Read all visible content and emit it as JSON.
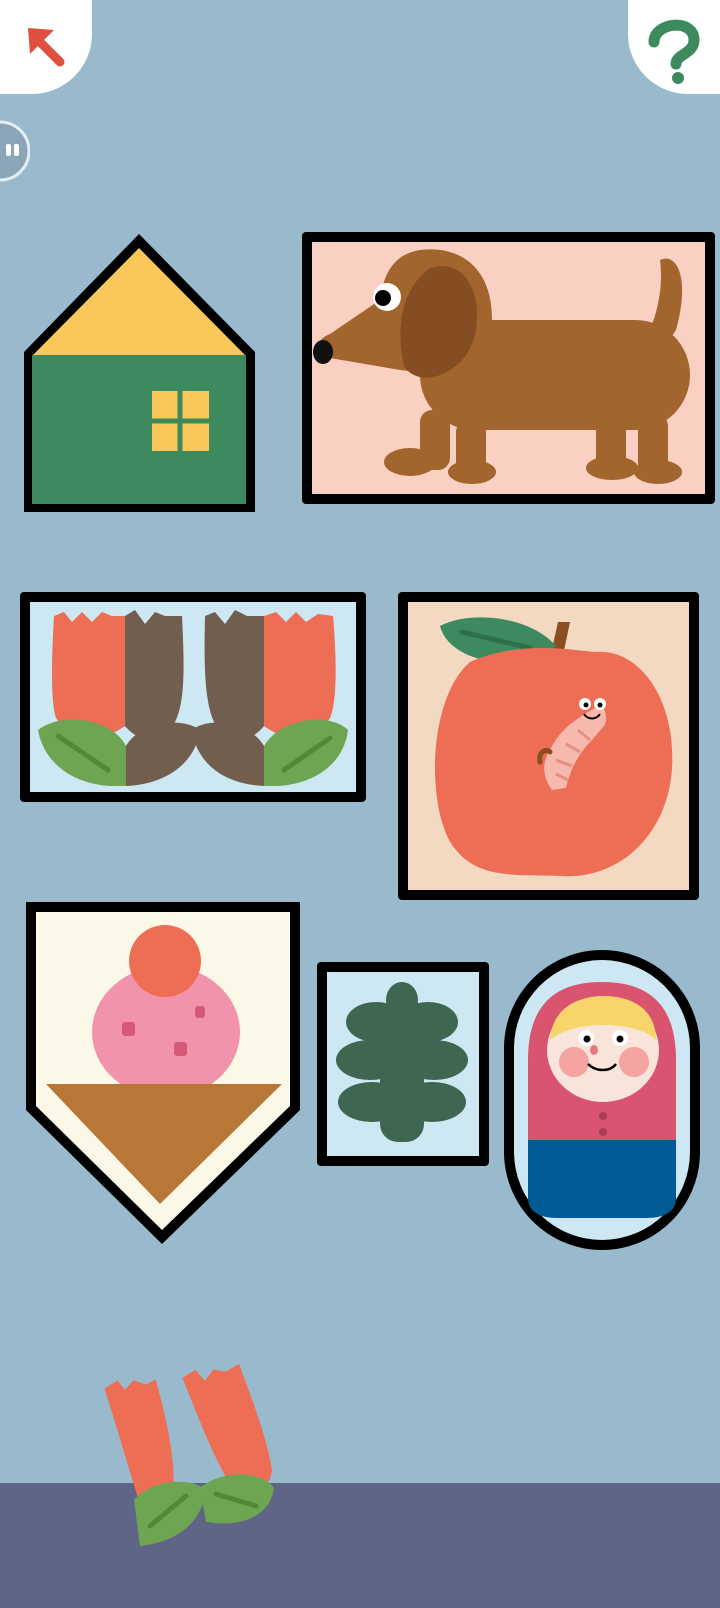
{
  "app": {
    "screen": "picture-frame-puzzle"
  },
  "hud": {
    "back_icon": "arrow-up-left-icon",
    "help_icon": "question-mark-icon",
    "pause_icon": "pause-icon"
  },
  "frames": [
    {
      "name": "frame-house",
      "picture": "house",
      "shape": "house"
    },
    {
      "name": "frame-dog",
      "picture": "dachshund-dog",
      "shape": "rectangle"
    },
    {
      "name": "frame-tulips",
      "picture": "tulips",
      "shape": "rectangle",
      "state": "half-filled"
    },
    {
      "name": "frame-apple",
      "picture": "apple-with-worm",
      "shape": "rectangle"
    },
    {
      "name": "frame-ice-cream",
      "picture": "ice-cream-cone",
      "shape": "pentagon"
    },
    {
      "name": "frame-leaf",
      "picture": "oak-leaf",
      "shape": "rectangle"
    },
    {
      "name": "frame-doll",
      "picture": "matryoshka-doll",
      "shape": "oval"
    }
  ],
  "draggable_piece": {
    "picture": "tulips",
    "fits": "frame-tulips"
  },
  "colors": {
    "wall": "#99bacc",
    "floor": "#5f6586",
    "frame_border": "#000000",
    "back_arrow": "#e05040",
    "help_mark": "#3c8a5e"
  }
}
